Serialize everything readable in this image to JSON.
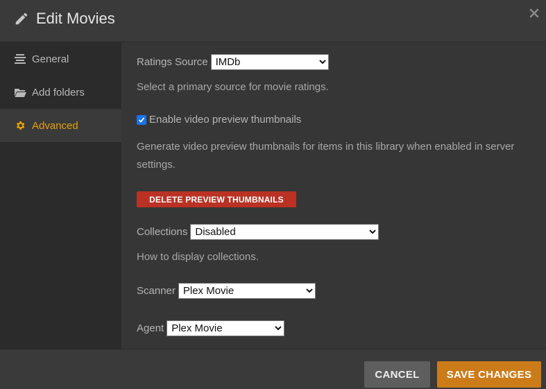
{
  "header": {
    "title": "Edit Movies",
    "icon": "pencil-icon",
    "close_icon": "close-icon"
  },
  "sidebar": {
    "items": [
      {
        "label": "General",
        "icon": "list-icon",
        "active": false
      },
      {
        "label": "Add folders",
        "icon": "folder-icon",
        "active": false
      },
      {
        "label": "Advanced",
        "icon": "gear-icon",
        "active": true
      }
    ]
  },
  "main": {
    "ratings_source": {
      "label": "Ratings Source",
      "value": "IMDb",
      "help": "Select a primary source for movie ratings."
    },
    "video_preview": {
      "label": "Enable video preview thumbnails",
      "checked": true,
      "help": "Generate video preview thumbnails for items in this library when enabled in server settings."
    },
    "delete_button": "DELETE PREVIEW THUMBNAILS",
    "collections": {
      "label": "Collections",
      "value": "Disabled",
      "help": "How to display collections."
    },
    "scanner": {
      "label": "Scanner",
      "value": "Plex Movie"
    },
    "agent": {
      "label": "Agent",
      "value": "Plex Movie"
    }
  },
  "footer": {
    "cancel_label": "CANCEL",
    "save_label": "SAVE CHANGES"
  },
  "colors": {
    "accent": "#e5a00d",
    "save": "#cc7b19",
    "danger": "#b93224",
    "cancel": "#5e5e5e"
  }
}
